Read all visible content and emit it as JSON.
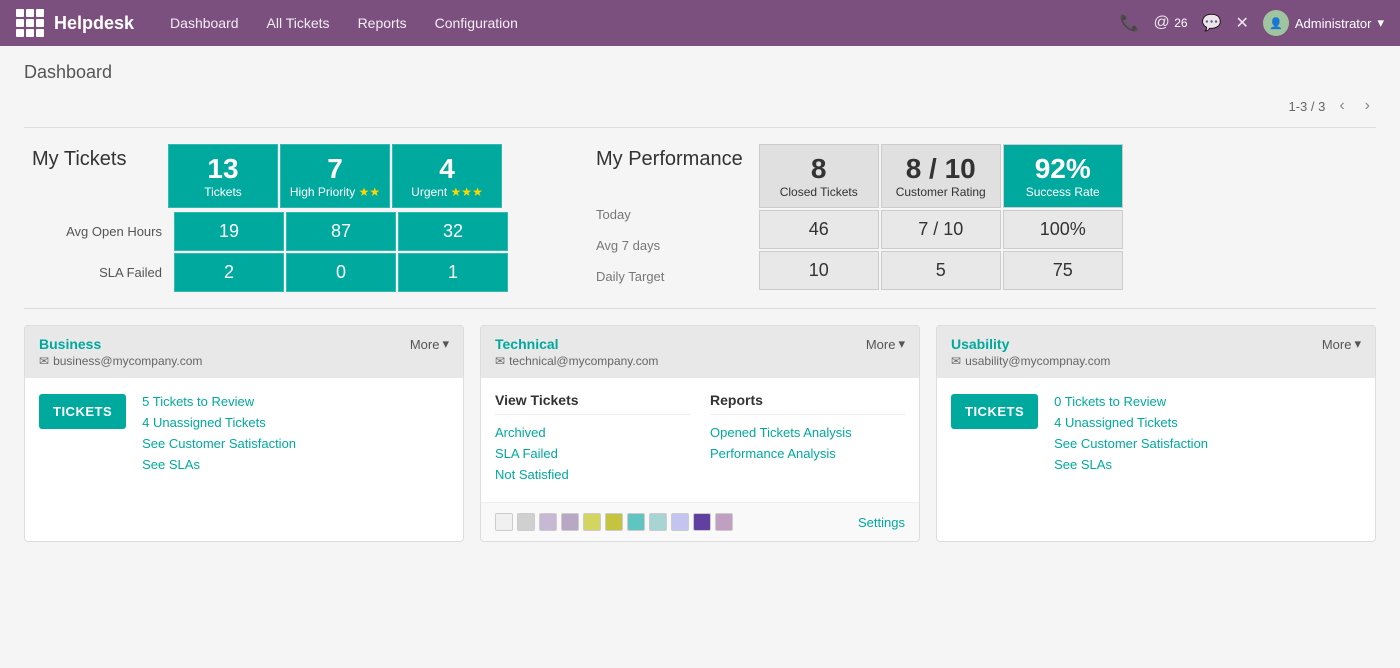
{
  "topnav": {
    "logo_text": "Helpdesk",
    "menu": [
      {
        "label": "Dashboard",
        "active": true
      },
      {
        "label": "All Tickets"
      },
      {
        "label": "Reports"
      },
      {
        "label": "Configuration"
      }
    ],
    "badge_count": "26",
    "user_name": "Administrator"
  },
  "page": {
    "title": "Dashboard",
    "pagination": "1-3 / 3"
  },
  "my_tickets": {
    "title": "My Tickets",
    "columns": [
      {
        "label": "13",
        "sublabel": "Tickets",
        "stars": ""
      },
      {
        "label": "7",
        "sublabel": "High Priority",
        "stars": "★★"
      },
      {
        "label": "4",
        "sublabel": "Urgent",
        "stars": "★★★"
      }
    ],
    "rows": [
      {
        "label": "Avg Open Hours",
        "values": [
          "19",
          "87",
          "32"
        ]
      },
      {
        "label": "SLA Failed",
        "values": [
          "2",
          "0",
          "1"
        ]
      }
    ]
  },
  "my_performance": {
    "title": "My Performance",
    "subtitle": "Today",
    "subtitle2": "Avg 7 days",
    "subtitle3": "Daily Target",
    "columns": [
      {
        "label": "8",
        "sublabel": "Closed Tickets",
        "accent": false
      },
      {
        "label": "8 / 10",
        "sublabel": "Customer Rating",
        "accent": false
      },
      {
        "label": "92%",
        "sublabel": "Success Rate",
        "accent": true
      }
    ],
    "rows": [
      {
        "values": [
          "46",
          "7 / 10",
          "100%"
        ]
      },
      {
        "values": [
          "10",
          "5",
          "75"
        ]
      }
    ]
  },
  "cards": [
    {
      "id": "business",
      "title": "Business",
      "email": "business@mycompany.com",
      "more_label": "More",
      "tickets_btn": "TICKETS",
      "tickets_to_review": "5 Tickets to Review",
      "unassigned": "4 Unassigned Tickets",
      "customer_satisfaction": "See Customer Satisfaction",
      "slas": "See SLAs"
    },
    {
      "id": "technical",
      "title": "Technical",
      "email": "technical@mycompany.com",
      "more_label": "More",
      "view_tickets_label": "View Tickets",
      "reports_label": "Reports",
      "view_links": [
        "Archived",
        "SLA Failed",
        "Not Satisfied"
      ],
      "report_links": [
        "Opened Tickets Analysis",
        "Performance Analysis"
      ],
      "color_swatches": [
        "#f0f0f0",
        "#d0d0d0",
        "#c9b8d4",
        "#b8a8c4",
        "#d4d460",
        "#c4c440",
        "#60c4c0",
        "#a8d4d4",
        "#c4c4f0",
        "#6040a0",
        "#c0a0c0"
      ],
      "settings_label": "Settings"
    },
    {
      "id": "usability",
      "title": "Usability",
      "email": "usability@mycompnay.com",
      "more_label": "More",
      "tickets_btn": "TICKETS",
      "tickets_to_review": "0 Tickets to Review",
      "unassigned": "4 Unassigned Tickets",
      "customer_satisfaction": "See Customer Satisfaction",
      "slas": "See SLAs"
    }
  ],
  "colors": {
    "primary": "#00A99D",
    "nav_bg": "#7B4F7E",
    "accent_text": "#00A99D"
  }
}
